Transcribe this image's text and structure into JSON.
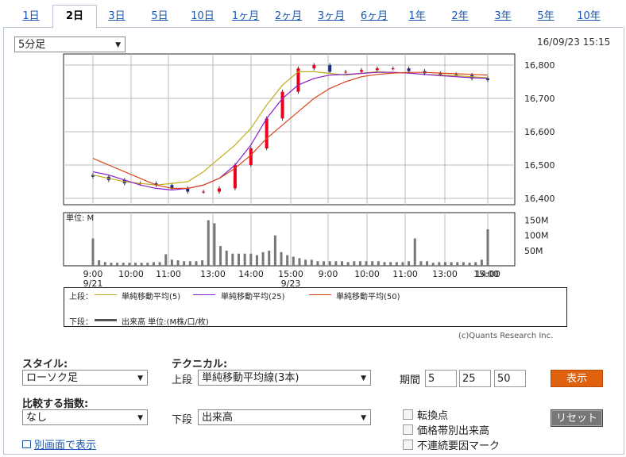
{
  "tabs": [
    "1日",
    "2日",
    "3日",
    "5日",
    "10日",
    "1ヶ月",
    "2ヶ月",
    "3ヶ月",
    "6ヶ月",
    "1年",
    "2年",
    "3年",
    "5年",
    "10年"
  ],
  "active_tab": 1,
  "interval_select": "5分足",
  "timestamp": "16/09/23 15:15",
  "chart_data": [
    {
      "type": "candlestick",
      "y_ticks": [
        "16,800",
        "16,700",
        "16,600",
        "16,500",
        "16,400"
      ],
      "ylim": [
        16400,
        16800
      ],
      "x_ticks": [
        "9:00",
        "10:00",
        "11:00",
        "13:00",
        "14:00",
        "15:00",
        "9:00",
        "10:00",
        "11:00",
        "13:00",
        "14:00",
        "15:00"
      ],
      "date_labels": [
        "9/21",
        "9/23"
      ],
      "colors": {
        "up": "#e8001c",
        "down": "#1f2d8a",
        "ma5": "#bfae1a",
        "ma25": "#8a1ec8",
        "ma50": "#d9451a"
      },
      "series": [
        {
          "name": "単純移動平均(5)",
          "values": [
            16470,
            16460,
            16450,
            16445,
            16440,
            16445,
            16450,
            16480,
            16520,
            16560,
            16610,
            16680,
            16740,
            16780,
            16780,
            16775,
            16770,
            16775,
            16780,
            16778,
            16776,
            16772,
            16770,
            16768,
            16765,
            16762
          ]
        },
        {
          "name": "単純移動平均(25)",
          "values": [
            16480,
            16470,
            16455,
            16440,
            16430,
            16425,
            16430,
            16440,
            16460,
            16500,
            16560,
            16640,
            16700,
            16740,
            16760,
            16770,
            16772,
            16775,
            16778,
            16778,
            16776,
            16772,
            16768,
            16765,
            16762,
            16760
          ]
        },
        {
          "name": "単純移動平均(50)",
          "values": [
            16520,
            16500,
            16480,
            16460,
            16440,
            16430,
            16430,
            16440,
            16460,
            16490,
            16530,
            16580,
            16620,
            16660,
            16700,
            16730,
            16750,
            16765,
            16772,
            16776,
            16778,
            16778,
            16776,
            16774,
            16772,
            16770
          ]
        }
      ],
      "close": [
        16465,
        16455,
        16445,
        16445,
        16440,
        16430,
        16420,
        16420,
        16430,
        16500,
        16550,
        16640,
        16720,
        16790,
        16800,
        16780,
        16780,
        16785,
        16790,
        16790,
        16782,
        16775,
        16772,
        16770,
        16760,
        16755
      ]
    },
    {
      "type": "bar",
      "y_unit_label": "単位: M",
      "y_ticks": [
        "150M",
        "100M",
        "50M"
      ],
      "ylim": [
        0,
        175
      ],
      "values": [
        90,
        18,
        12,
        10,
        10,
        10,
        10,
        10,
        10,
        10,
        12,
        12,
        38,
        20,
        18,
        15,
        15,
        15,
        18,
        150,
        140,
        65,
        50,
        40,
        40,
        40,
        40,
        35,
        45,
        50,
        100,
        45,
        35,
        30,
        25,
        20,
        20,
        15,
        15,
        15,
        15,
        15,
        12,
        15,
        15,
        15,
        15,
        15,
        12,
        12,
        12,
        12,
        15,
        90,
        15,
        15,
        10,
        12,
        12,
        12,
        12,
        12,
        10,
        12,
        20,
        120
      ],
      "series": [
        {
          "name": "出来高 単位:(M株/口/枚)",
          "values": [
            90,
            18,
            12,
            10,
            10,
            10,
            10,
            10,
            10,
            10,
            12,
            12,
            38,
            20,
            18,
            15,
            15,
            15,
            18,
            150,
            140,
            65,
            50,
            40,
            40,
            40,
            40,
            35,
            45,
            50,
            100,
            45,
            35,
            30,
            25,
            20,
            20,
            15,
            15,
            15,
            15,
            15,
            12,
            15,
            15,
            15,
            15,
            15,
            12,
            12,
            12,
            12,
            15,
            90,
            15,
            15,
            10,
            12,
            12,
            12,
            12,
            12,
            10,
            12,
            20,
            120
          ]
        }
      ]
    }
  ],
  "legend": {
    "upper_label": "上段：",
    "lower_label": "下段：",
    "items": [
      "単純移動平均(5)",
      "単純移動平均(25)",
      "単純移動平均(50)"
    ],
    "volume": "出来高 単位:(M株/口/枚)"
  },
  "credit": "(c)Quants Research Inc.",
  "controls": {
    "style_label": "スタイル:",
    "style_value": "ローソク足",
    "technical_label": "テクニカル:",
    "upper_label": "上段",
    "upper_value": "単純移動平均線(3本)",
    "period_label": "期間",
    "periods": [
      "5",
      "25",
      "50"
    ],
    "show_button": "表示",
    "compare_label": "比較する指数:",
    "compare_value": "なし",
    "lower_label": "下段",
    "lower_value": "出来高",
    "reset_button": "リセット",
    "checkboxes": [
      "転換点",
      "価格帯別出来高",
      "不連続要因マーク"
    ],
    "popup_link": "別画面で表示"
  }
}
